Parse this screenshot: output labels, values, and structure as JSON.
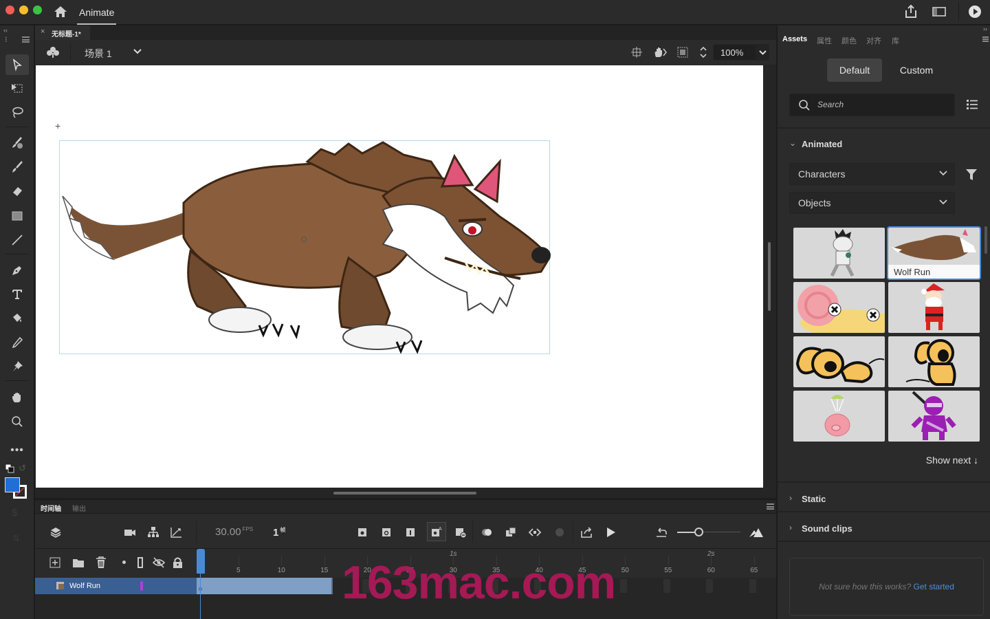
{
  "titlebar": {
    "app_name": "Animate",
    "window_controls": [
      "close",
      "minimize",
      "zoom"
    ],
    "colors": {
      "close": "#ed5f57",
      "minimize": "#f5bc2f",
      "zoom": "#3ec244"
    },
    "right_icons": [
      "share-icon",
      "panel-layout-icon",
      "play-preview-icon"
    ]
  },
  "document": {
    "tab_title": "无标题-1*",
    "scene_label": "场景 1",
    "zoom_level": "100%"
  },
  "toolbar": {
    "tools": [
      "selection-tool",
      "free-transform-tool",
      "lasso-tool",
      "paint-brush-tool",
      "brush-tool",
      "eraser-tool",
      "rectangle-tool",
      "line-tool",
      "pen-tool",
      "text-tool",
      "paint-bucket-tool",
      "eyedropper-tool",
      "pin-tool",
      "hand-tool",
      "zoom-tool",
      "more-tools"
    ],
    "fill_color": "#1f6fd6",
    "stroke_color": "#ffffff"
  },
  "stage": {
    "symbol_name": "Wolf Run"
  },
  "timeline": {
    "tabs": [
      "时间轴",
      "输出"
    ],
    "active_tab": "时间轴",
    "fps": "30.00",
    "fps_unit": "FPS",
    "current_frame": "1",
    "frame_unit": "帧",
    "ruler_frames": [
      "5",
      "10",
      "15",
      "20",
      "25",
      "30",
      "35",
      "40",
      "45",
      "50",
      "55",
      "60",
      "65"
    ],
    "ruler_seconds": [
      "1s",
      "2s"
    ],
    "layers": [
      {
        "name": "Wolf Run",
        "tween_end_frame": 16,
        "selected": true
      }
    ],
    "watermark": "163mac.com"
  },
  "right_panel": {
    "tabs": [
      "Assets",
      "属性",
      "颜色",
      "对齐",
      "库"
    ],
    "active_tab": "Assets",
    "segments": [
      "Default",
      "Custom"
    ],
    "active_segment": "Default",
    "search_placeholder": "Search",
    "animated_section": "Animated",
    "category_dropdown": "Characters",
    "subcategory_dropdown": "Objects",
    "assets": [
      {
        "name": "Mummy"
      },
      {
        "name": "Wolf Run",
        "selected": true
      },
      {
        "name": "Snail"
      },
      {
        "name": "Santa"
      },
      {
        "name": "Dog Lying"
      },
      {
        "name": "Dog Sitting"
      },
      {
        "name": "Parachute Pig"
      },
      {
        "name": "Ninja"
      }
    ],
    "show_next": "Show next ↓",
    "static_section": "Static",
    "sound_section": "Sound clips",
    "help_text": "Not sure how this works?",
    "help_link": "Get started",
    "link_color": "#4e8fe0"
  }
}
